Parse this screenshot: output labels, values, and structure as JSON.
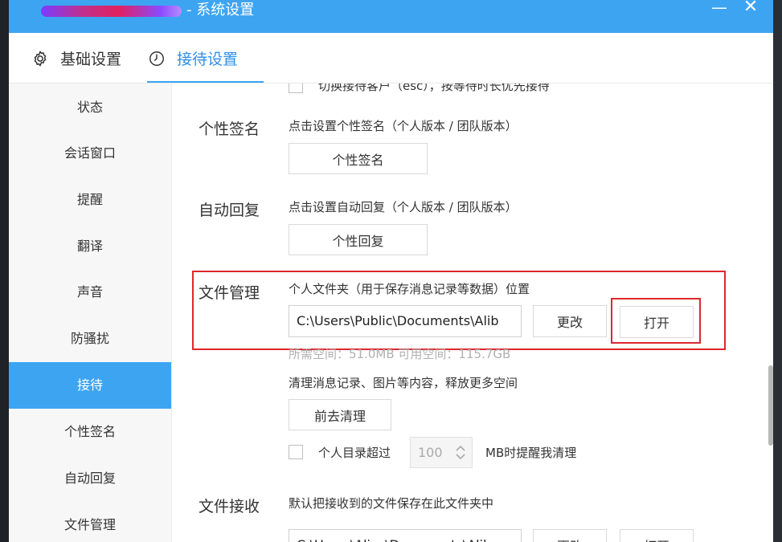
{
  "window": {
    "title": "- 系统设置",
    "minimize_label": "—",
    "close_label": "✕"
  },
  "tabs": [
    {
      "label": "基础设置",
      "icon": "gear-icon"
    },
    {
      "label": "接待设置",
      "icon": "clock-icon",
      "active": true
    }
  ],
  "sidebar": {
    "items": [
      {
        "label": "状态"
      },
      {
        "label": "会话窗口"
      },
      {
        "label": "提醒"
      },
      {
        "label": "翻译"
      },
      {
        "label": "声音"
      },
      {
        "label": "防骚扰"
      },
      {
        "label": "接待",
        "active": true
      },
      {
        "label": "个性签名"
      },
      {
        "label": "自动回复"
      },
      {
        "label": "文件管理"
      }
    ]
  },
  "content": {
    "top_partial_option": "切换接待客户（esc），按等待时长优先接待",
    "signature": {
      "title": "个性签名",
      "desc": "点击设置个性签名（个人版本 / 团队版本）",
      "button": "个性签名"
    },
    "auto_reply": {
      "title": "自动回复",
      "desc": "点击设置自动回复（个人版本 / 团队版本）",
      "button": "个性回复"
    },
    "file_management": {
      "title": "文件管理",
      "desc": "个人文件夹（用于保存消息记录等数据）位置",
      "path": "C:\\Users\\Public\\Documents\\Alib",
      "change_button": "更改",
      "open_button": "打开",
      "space_info": "所需空间：51.0MB   可用空间：115.7GB",
      "cleanup_desc": "清理消息记录、图片等内容，释放更多空间",
      "cleanup_button": "前去清理",
      "remind_prefix": "个人目录超过",
      "remind_value": "100",
      "remind_suffix": "MB时提醒我清理"
    },
    "file_receive": {
      "title": "文件接收",
      "desc": "默认把接收到的文件保存在此文件夹中",
      "path_partial": "C:\\Users\\Alias\\Documents\\Alib",
      "change_button": "更改",
      "open_button": "打开"
    }
  },
  "colors": {
    "accent": "#3da4f2",
    "highlight": "#e0262d"
  }
}
